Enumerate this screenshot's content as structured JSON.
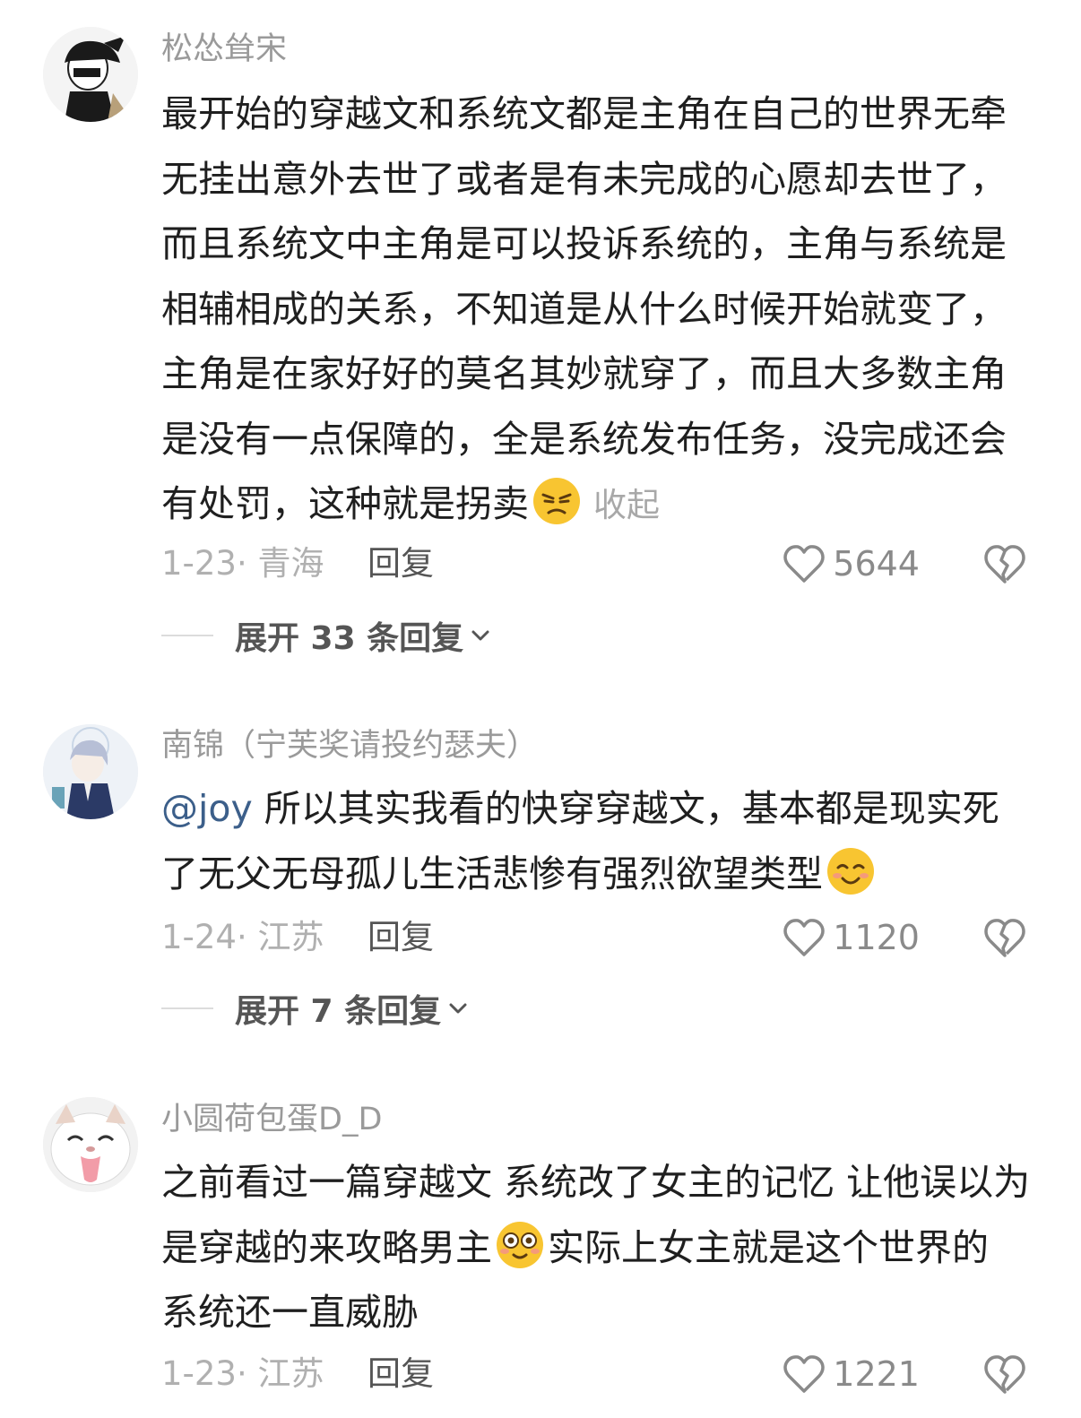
{
  "comments": [
    {
      "username": "松怂耸宋",
      "text_before_emoji": "最开始的穿越文和系统文都是主角在自己的世界无牵无挂出意外去世了或者是有未完成的心愿却去世了，而且系统文中主角是可以投诉系统的，主角与系统是相辅相成的关系，不知道是从什么时候开始就变了，主角是在家好好的莫名其妙就穿了，而且大多数主角是没有一点保障的，全是系统发布任务，没完成还会有处罚，这种就是拐卖",
      "emoji": "annoyed-face-emoji",
      "collapse_label": "收起",
      "date_location": "1-23· 青海",
      "reply_label": "回复",
      "likes": "5644",
      "expand_label": "展开 33 条回复"
    },
    {
      "username": "南锦（宁芙奖请投约瑟夫）",
      "mention": "@joy",
      "text_before_emoji": " 所以其实我看的快穿穿越文，基本都是现实死了无父无母孤儿生活悲惨有强烈欲望类型",
      "emoji": "smiling-face-emoji",
      "date_location": "1-24· 江苏",
      "reply_label": "回复",
      "likes": "1120",
      "expand_label": "展开 7 条回复"
    },
    {
      "username": "小圆荷包蛋D_D",
      "text_before_emoji": "之前看过一篇穿越文 系统改了女主的记忆 让他误以为是穿越的来攻略男主",
      "emoji": "dizzy-eyes-emoji",
      "text_after_emoji": "实际上女主就是这个世界的  系统还一直威胁",
      "date_location": "1-23· 江苏",
      "reply_label": "回复",
      "likes": "1221"
    }
  ],
  "colors": {
    "username": "#9a9a9a",
    "text": "#1f1f1f",
    "mention": "#3c5f8a",
    "meta": "#b0b0b0"
  }
}
